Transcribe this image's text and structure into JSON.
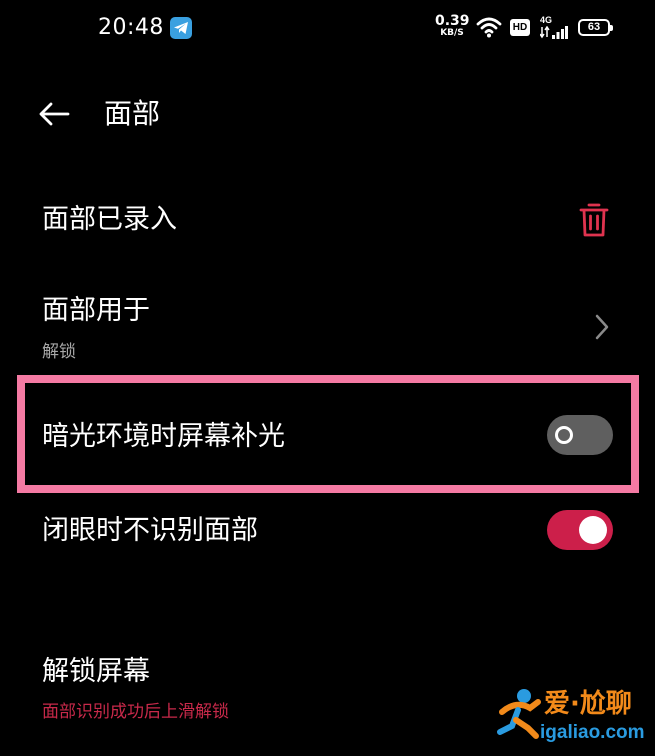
{
  "status_bar": {
    "time": "20:48",
    "net_speed_value": "0.39",
    "net_speed_unit": "KB/S",
    "hd_label": "HD",
    "cell_label": "4G",
    "battery_level": "63",
    "icons": [
      "telegram-icon",
      "wifi-icon",
      "hd-icon",
      "signal-4g-icon",
      "battery-icon"
    ]
  },
  "header": {
    "title": "面部",
    "back_icon": "arrow-left-icon"
  },
  "settings": {
    "face_enrolled": {
      "label": "面部已录入",
      "action_icon": "trash-icon",
      "action_color": "#e0334f"
    },
    "face_used_for": {
      "label": "面部用于",
      "value": "解锁"
    },
    "low_light_fill": {
      "label": "暗光环境时屏幕补光",
      "enabled": false
    },
    "eyes_closed": {
      "label": "闭眼时不识别面部",
      "enabled": true
    },
    "unlock_screen": {
      "label": "解锁屏幕",
      "value": "面部识别成功后上滑解锁",
      "value_color": "#c8294a"
    }
  },
  "highlight": {
    "target": "low_light_fill",
    "color": "#f47aa3"
  },
  "watermark": {
    "brand": "爱·尬聊",
    "url": "igaliao.com"
  },
  "colors": {
    "background": "#000000",
    "accent_red": "#cc1f4a",
    "toggle_off": "#5f5f5f"
  }
}
